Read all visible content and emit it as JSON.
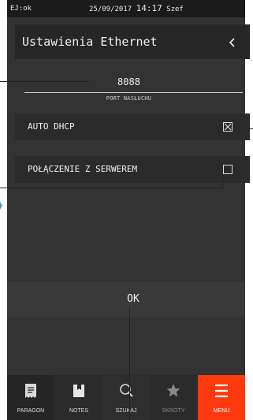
{
  "status_bar": {
    "left": "EJ:ok",
    "date": "25/09/2017",
    "time": "14:17",
    "user": "Szef"
  },
  "title": "Ustawienia Ethernet",
  "back_icon": "chevron-left-icon",
  "port": {
    "value": "8088",
    "label": "PORT NASŁUCHU"
  },
  "options": [
    {
      "label": "AUTO DHCP",
      "checked": true
    },
    {
      "label": "POŁĄCZENIE Z SERWEREM",
      "checked": false
    }
  ],
  "ok_label": "OK",
  "tabs": [
    {
      "label": "PARAGON",
      "icon": "receipt-icon"
    },
    {
      "label": "NOTES",
      "icon": "notes-icon"
    },
    {
      "label": "SZUKAJ",
      "icon": "search-icon"
    },
    {
      "label": "SKRÓTY",
      "icon": "star-icon"
    },
    {
      "label": "MENU",
      "icon": "menu-icon"
    }
  ],
  "colors": {
    "accent": "#ff3a0f",
    "background": "#333333"
  }
}
